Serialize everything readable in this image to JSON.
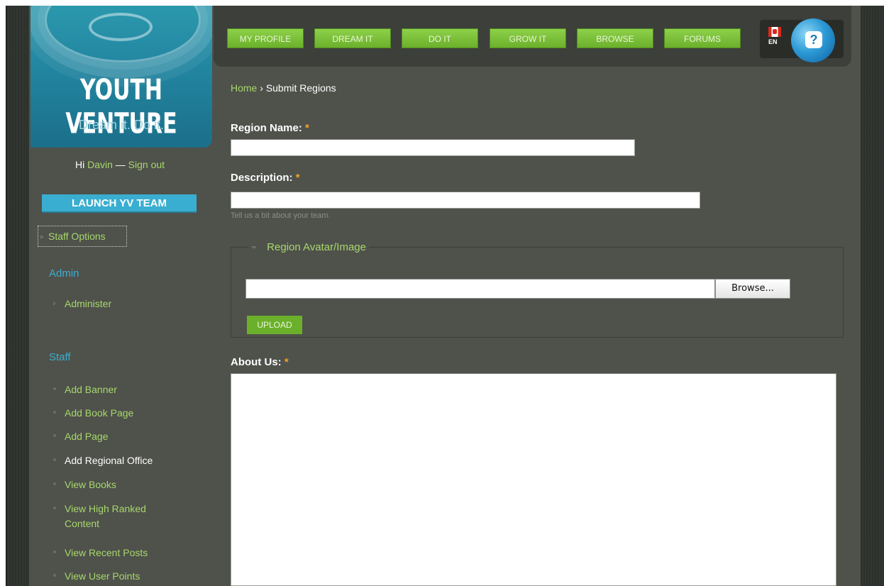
{
  "logo": {
    "title": "YOUTH VENTURE",
    "tagline": "Dream it. Do it."
  },
  "user": {
    "greeting": "Hi",
    "name": "Davin",
    "separator": "—",
    "signout": "Sign out"
  },
  "sidebar": {
    "launch_button": "LAUNCH YV TEAM",
    "staff_options": "Staff Options",
    "admin_title": "Admin",
    "admin_items": [
      "Administer"
    ],
    "staff_title": "Staff",
    "staff_items": [
      "Add Banner",
      "Add Book Page",
      "Add Page",
      "Add Regional Office",
      "View Books",
      "View High Ranked",
      "Content",
      "View Recent Posts",
      "View User Points"
    ]
  },
  "nav": {
    "items": [
      "MY PROFILE",
      "DREAM IT",
      "DO IT",
      "GROW IT",
      "BROWSE",
      "FORUMS"
    ],
    "language": "EN",
    "help": "?"
  },
  "breadcrumb": {
    "home": "Home",
    "sep": "›",
    "current": "Submit Regions"
  },
  "form": {
    "region_name_label": "Region Name:",
    "description_label": "Description:",
    "required_mark": "*",
    "description_help": "Tell us a bit about your team.",
    "avatar_legend": "Region Avatar/Image",
    "browse_label": "Browse...",
    "upload_label": "UPLOAD",
    "about_label": "About Us:",
    "region_name_value": "",
    "description_value": ""
  },
  "colors": {
    "accent_green": "#a6d86b",
    "accent_blue": "#3ab0d2",
    "button_green": "#6bb02b",
    "required": "#f0a22b"
  }
}
